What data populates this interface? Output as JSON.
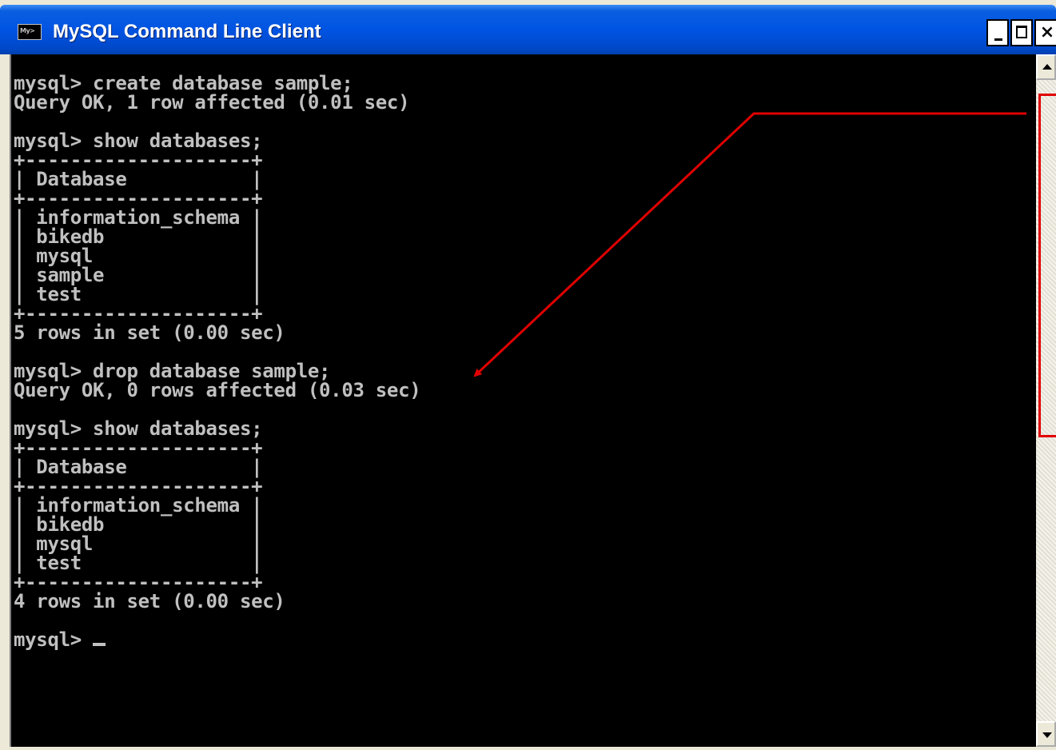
{
  "window": {
    "title": "MySQL Command Line Client",
    "icon_name": "mysql-console-icon",
    "icon_text": "My>",
    "buttons": {
      "minimize": "minimize-icon",
      "maximize": "maximize-icon",
      "close": "×"
    }
  },
  "console": {
    "lines": [
      "mysql> create database sample;",
      "Query OK, 1 row affected (0.01 sec)",
      "",
      "mysql> show databases;",
      "+--------------------+",
      "| Database           |",
      "+--------------------+",
      "| information_schema |",
      "| bikedb             |",
      "| mysql              |",
      "| sample             |",
      "| test               |",
      "+--------------------+",
      "5 rows in set (0.00 sec)",
      "",
      "mysql> drop database sample;",
      "Query OK, 0 rows affected (0.03 sec)",
      "",
      "mysql> show databases;",
      "+--------------------+",
      "| Database           |",
      "+--------------------+",
      "| information_schema |",
      "| bikedb             |",
      "| mysql              |",
      "| test               |",
      "+--------------------+",
      "4 rows in set (0.00 sec)",
      "",
      "mysql> "
    ],
    "text_color": "#c0c0c0",
    "background": "#000000"
  },
  "annotation": {
    "color": "#e00000"
  }
}
